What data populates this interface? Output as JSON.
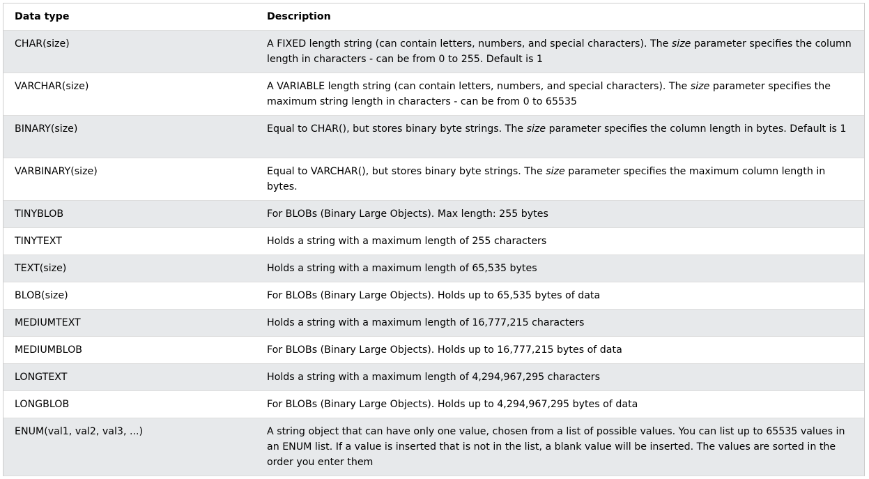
{
  "header": {
    "col1": "Data type",
    "col2": "Description"
  },
  "rows": [
    {
      "type": "CHAR(size)",
      "desc_pre": "A FIXED length string (can contain letters, numbers, and special characters). The ",
      "desc_em": "size",
      "desc_post": " parameter specifies the column length in characters - can be from 0 to 255. Default is 1"
    },
    {
      "type": "VARCHAR(size)",
      "desc_pre": "A VARIABLE length string (can contain letters, numbers, and special characters). The ",
      "desc_em": "size",
      "desc_post": " parameter specifies the maximum string length in characters - can be from 0 to 65535"
    },
    {
      "type": "BINARY(size)",
      "desc_pre": "Equal to CHAR(), but stores binary byte strings. The ",
      "desc_em": "size",
      "desc_post": " parameter specifies the column length in bytes. Default is 1"
    },
    {
      "type": "VARBINARY(size)",
      "desc_pre": "Equal to VARCHAR(), but stores binary byte strings. The ",
      "desc_em": "size",
      "desc_post": " parameter specifies the maximum column length in bytes."
    },
    {
      "type": "TINYBLOB",
      "desc": "For BLOBs (Binary Large Objects). Max length: 255 bytes"
    },
    {
      "type": "TINYTEXT",
      "desc": "Holds a string with a maximum length of 255 characters"
    },
    {
      "type": "TEXT(size)",
      "desc": "Holds a string with a maximum length of 65,535 bytes"
    },
    {
      "type": "BLOB(size)",
      "desc": "For BLOBs (Binary Large Objects). Holds up to 65,535 bytes of data"
    },
    {
      "type": "MEDIUMTEXT",
      "desc": "Holds a string with a maximum length of 16,777,215 characters"
    },
    {
      "type": "MEDIUMBLOB",
      "desc": "For BLOBs (Binary Large Objects). Holds up to 16,777,215 bytes of data"
    },
    {
      "type": "LONGTEXT",
      "desc": "Holds a string with a maximum length of 4,294,967,295 characters"
    },
    {
      "type": "LONGBLOB",
      "desc": "For BLOBs (Binary Large Objects). Holds up to 4,294,967,295 bytes of data"
    },
    {
      "type": "ENUM(val1, val2, val3, ...)",
      "desc": "A string object that can have only one value, chosen from a list of possible values. You can list up to 65535 values in an ENUM list. If a value is inserted that is not in the list, a blank value will be inserted. The values are sorted in the order you enter them"
    }
  ],
  "colors": {
    "row_shade": "#e7e9eb",
    "row_plain": "#ffffff",
    "border": "#dddddd"
  }
}
